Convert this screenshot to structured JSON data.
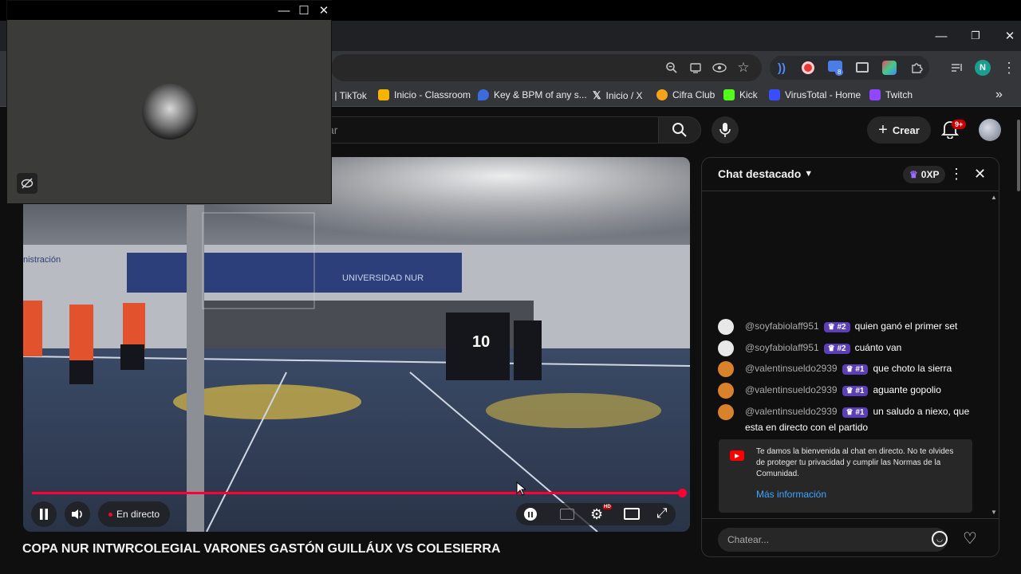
{
  "browser": {
    "window_controls": {
      "minimize": "—",
      "restore": "❐",
      "close": "✕"
    },
    "profile_initial": "N",
    "extension_badge": "8",
    "bookmarks": [
      {
        "label": "s | TikTok",
        "color": "#111111"
      },
      {
        "label": "Inicio - Classroom",
        "color": "#f4b400"
      },
      {
        "label": "Key & BPM of any s...",
        "color": "#3b6bdc"
      },
      {
        "label": "Inicio / X",
        "color": "#000000"
      },
      {
        "label": "Cifra Club",
        "color": "#f7a21b"
      },
      {
        "label": "Kick",
        "color": "#53fc18"
      },
      {
        "label": "VirusTotal - Home",
        "color": "#394eff"
      },
      {
        "label": "Twitch",
        "color": "#9146ff"
      }
    ],
    "more_bookmarks": "»"
  },
  "pip_window": {
    "controls": {
      "minimize": "—",
      "maximize": "☐",
      "close": "✕"
    }
  },
  "youtube": {
    "search_placeholder": "ar",
    "create_label": "Crear",
    "notifications_badge": "9+"
  },
  "video": {
    "live_label": "En directo",
    "title": "COPA NUR INTWRCOLEGIAL VARONES GASTÓN GUILLÁUX VS COLESIERRA",
    "progress": 1.0,
    "scene_text": {
      "jersey": "10",
      "banner": "UNIVERSIDAD NUR",
      "wall": "nistración"
    }
  },
  "chat": {
    "header_label": "Chat destacado",
    "xp_label": "0XP",
    "messages": [
      {
        "user": "@soyfabiolaff951",
        "rank": "#2",
        "text": "quien ganó el primer set",
        "avatar_color": "#e8e8e8"
      },
      {
        "user": "@soyfabiolaff951",
        "rank": "#2",
        "text": "cuánto van",
        "avatar_color": "#e8e8e8"
      },
      {
        "user": "@valentinsueldo2939",
        "rank": "#1",
        "text": "que choto la sierra",
        "avatar_color": "#d9822b"
      },
      {
        "user": "@valentinsueldo2939",
        "rank": "#1",
        "text": "aguante gopolio",
        "avatar_color": "#d9822b"
      },
      {
        "user": "@valentinsueldo2939",
        "rank": "#1",
        "text": "un saludo a niexo, que esta en directo con el partido",
        "avatar_color": "#d9822b"
      }
    ],
    "welcome_text": "Te damos la bienvenida al chat en directo. No te olvides de proteger tu privacidad y cumplir las Normas de la Comunidad.",
    "welcome_link": "Más información",
    "input_placeholder": "Chatear..."
  }
}
